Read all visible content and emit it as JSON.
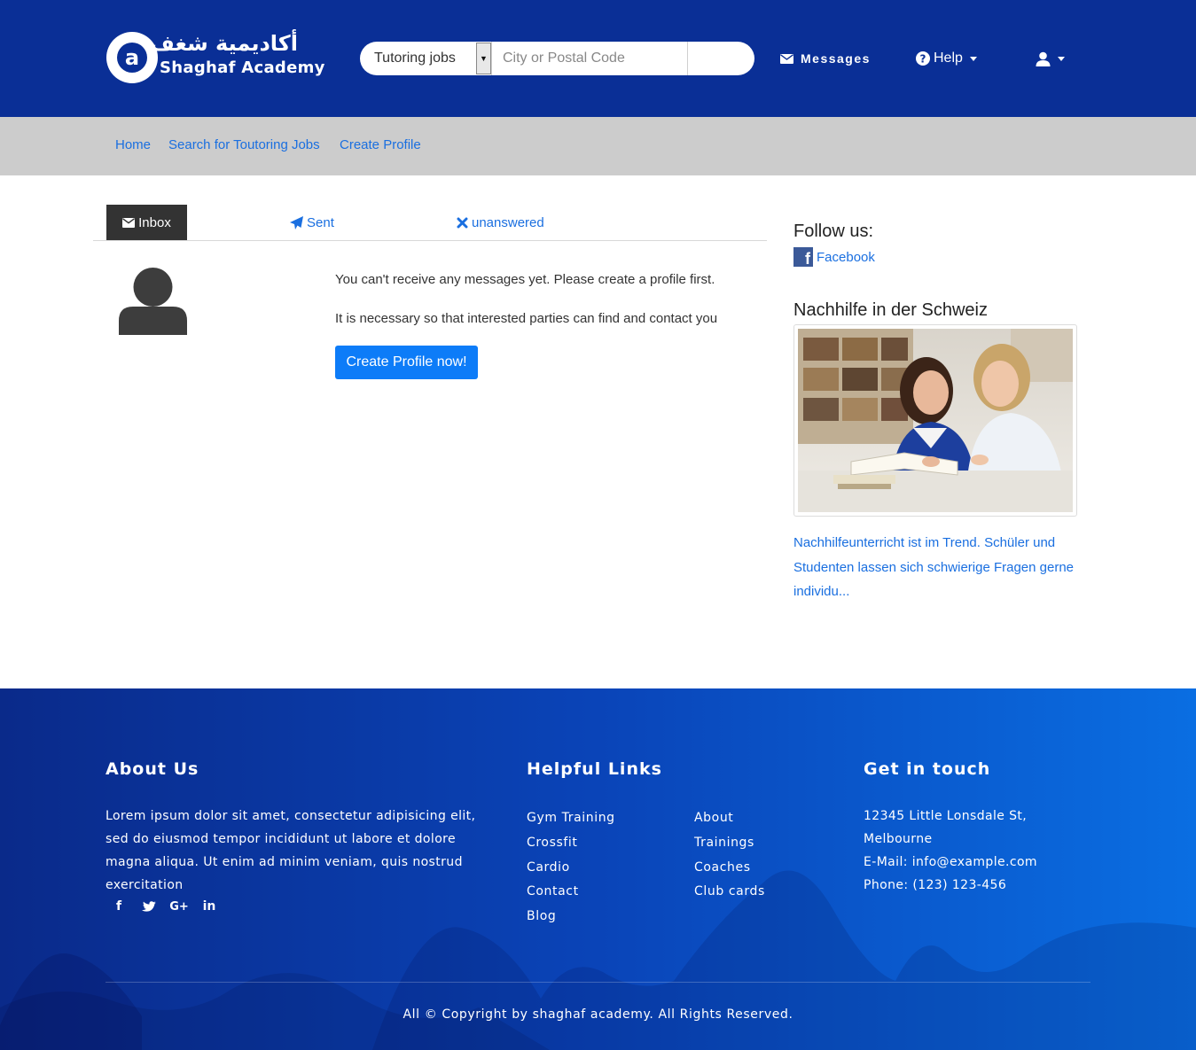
{
  "header": {
    "logo_arabic": "أكاديمية شغف",
    "logo_latin": "Shaghaf Academy",
    "search": {
      "category_value": "Tutoring jobs",
      "location_placeholder": "City or Postal Code"
    },
    "nav": {
      "messages": "Messages",
      "help": "Help"
    }
  },
  "subnav": {
    "items": [
      "Home",
      "Search for Toutoring Jobs",
      "Create Profile"
    ]
  },
  "tabs": {
    "inbox": "Inbox",
    "sent": "Sent",
    "unanswered": "unanswered"
  },
  "main": {
    "message_1": "You can't receive any messages yet. Please create a profile first.",
    "message_2": "It is necessary so that interested parties can find and contact you",
    "create_button": "Create Profile now!"
  },
  "sidebar": {
    "follow_heading": "Follow us:",
    "facebook_label": "Facebook",
    "article_heading": "Nachhilfe in der Schweiz",
    "article_text": "Nachhilfeunterricht ist im Trend. Schüler und Studenten lassen sich schwierige Fragen gerne individu..."
  },
  "footer": {
    "about": {
      "heading": "About Us",
      "text": "Lorem ipsum dolor sit amet, consectetur adipisicing elit, sed do eiusmod tempor incididunt ut labore et dolore magna aliqua. Ut enim ad minim veniam, quis nostrud exercitation"
    },
    "links": {
      "heading": "Helpful Links",
      "col1": [
        "Gym Training",
        "Crossfit",
        "Cardio",
        "Contact",
        "Blog"
      ],
      "col2": [
        "About",
        "Trainings",
        "Coaches",
        "Club cards"
      ]
    },
    "contact": {
      "heading": "Get in touch",
      "address_1": "12345 Little Lonsdale St,",
      "address_2": "Melbourne",
      "email": "E-Mail: info@example.com",
      "phone": "Phone: (123) 123-456"
    },
    "copyright": "All © Copyright by shaghaf academy. All Rights Reserved."
  },
  "colors": {
    "header_bg": "#0a2f96",
    "subnav_bg": "#cccccc",
    "link": "#1a6fe0",
    "primary_button": "#0d7cf8",
    "tab_active_bg": "#333333"
  },
  "icons": {
    "messages": "envelope-icon",
    "help": "question-circle-icon",
    "user": "user-icon",
    "sent": "paper-plane-icon",
    "unanswered": "times-icon",
    "facebook": "facebook-square-icon"
  }
}
